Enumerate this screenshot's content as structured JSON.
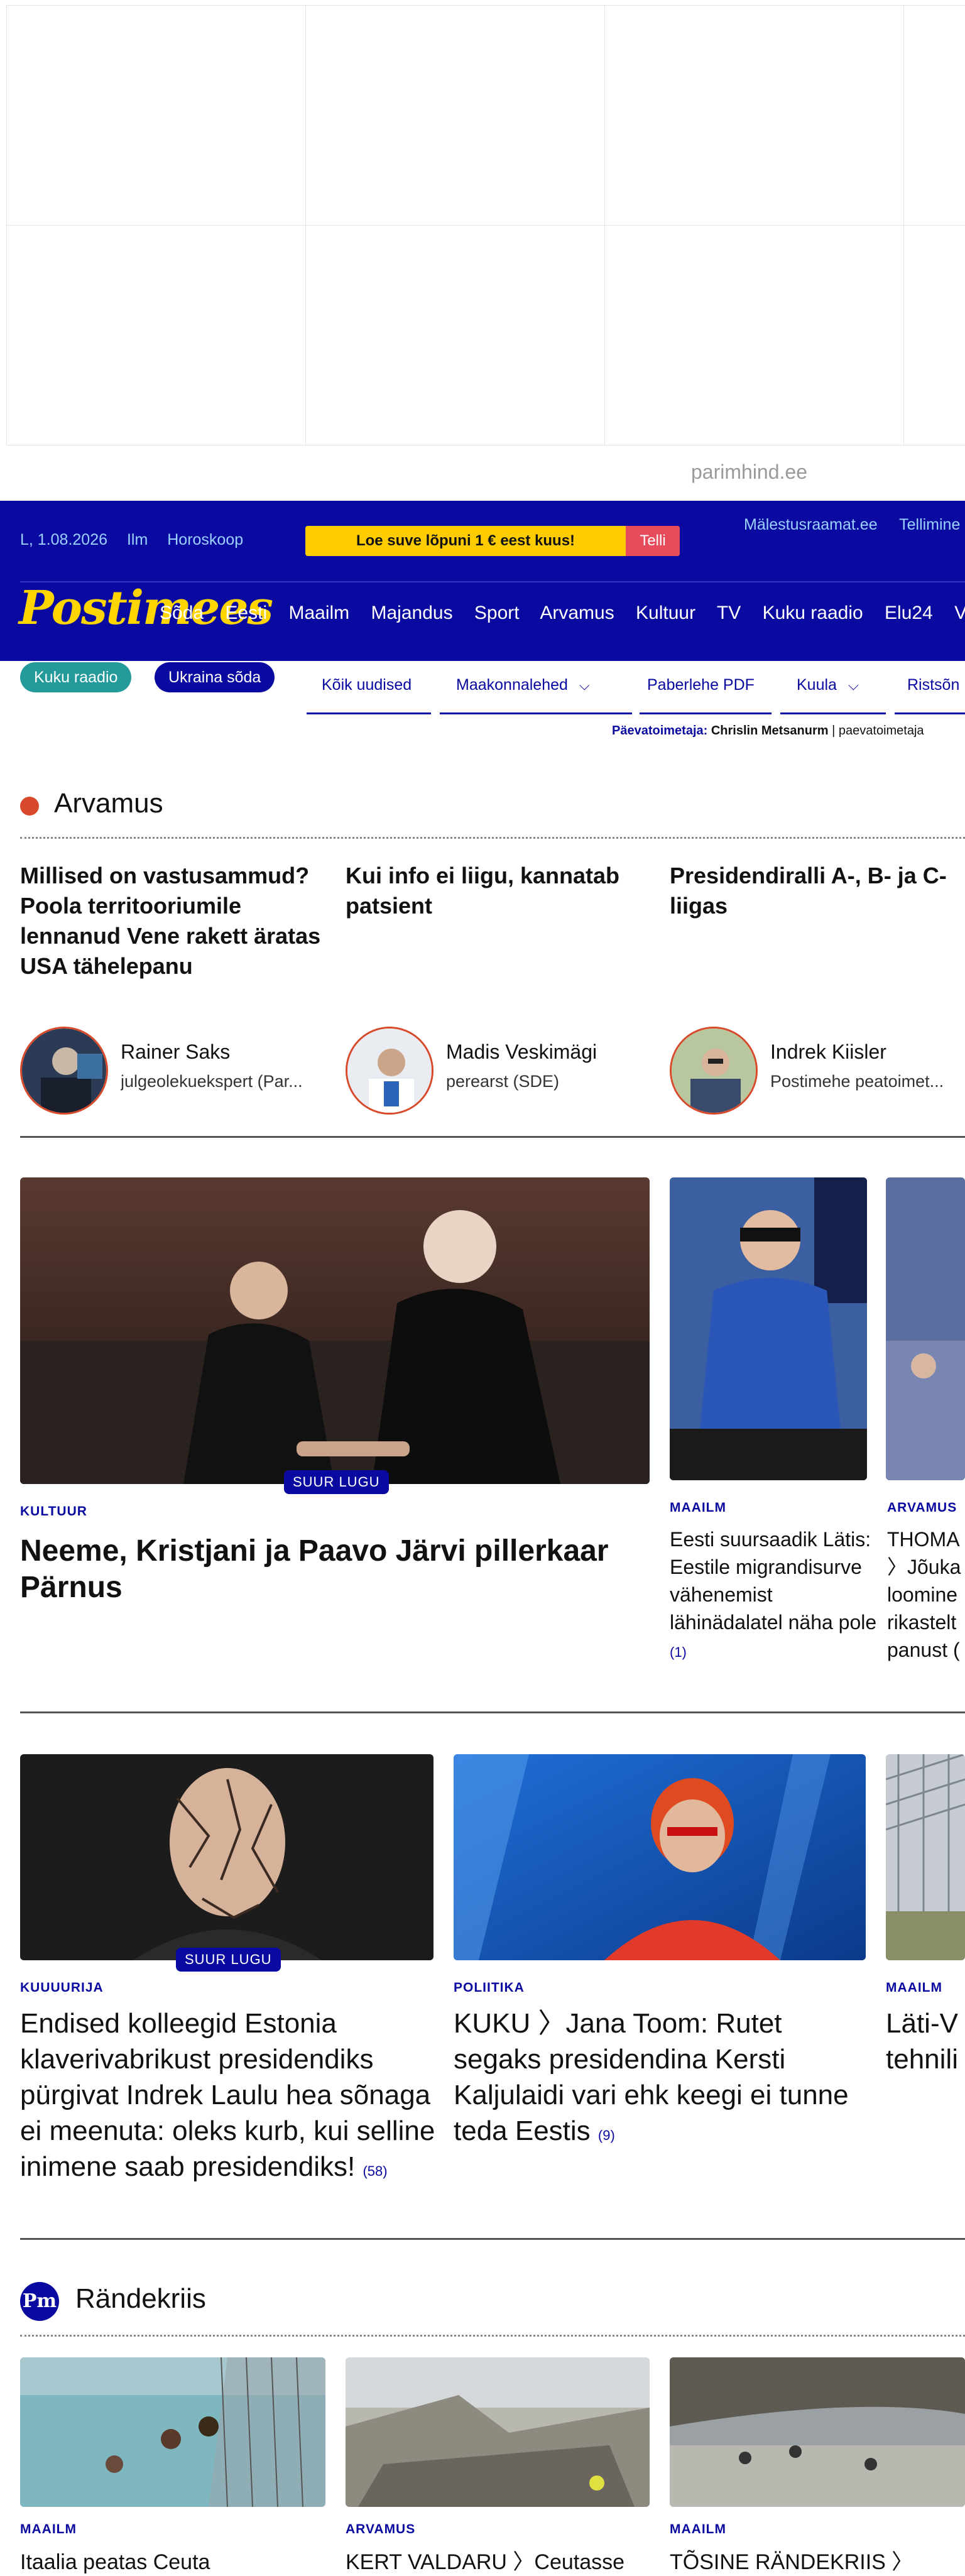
{
  "ad": {
    "source": "parimhind.ee"
  },
  "header": {
    "date": "L, 1.08.2026",
    "weather": "Ilm",
    "horoscope": "Horoskoop",
    "promo_text": "Loe suve lõpuni 1 € eest kuus!",
    "promo_button": "Telli",
    "top_links": [
      "Mälestusraamat.ee",
      "Tellimine"
    ],
    "logo": "Postimees",
    "nav": [
      "Sõda",
      "Eesti",
      "Maailm",
      "Majandus",
      "Sport",
      "Arvamus",
      "Kultuur",
      "TV",
      "Kuku raadio",
      "Elu24",
      "Vee"
    ]
  },
  "subnav": {
    "pills": [
      "Kuku raadio",
      "Ukraina sõda"
    ],
    "tabs": [
      "Kõik uudised",
      "Maakonnalehed",
      "Paberlehe PDF",
      "Kuula",
      "Ristsõn"
    ],
    "editor_label": "Päevatoimetaja:",
    "editor_name": "Chrislin Metsanurm",
    "editor_extra": "paevatoimetaja"
  },
  "opinion": {
    "title": "Arvamus",
    "items": [
      {
        "headline": "Millised on vastusammud? Poola territooriumile lennanud Vene rakett äratas USA tähelepanu",
        "author": "Rainer Saks",
        "role": "julgeolekuekspert (Par..."
      },
      {
        "headline": "Kui info ei liigu, kannatab patsient",
        "author": "Madis Veskimägi",
        "role": "perearst (SDE)"
      },
      {
        "headline": "Presidendiralli A-, B- ja C-liigas",
        "author": "Indrek Kiisler",
        "role": "Postimehe peatoimet..."
      }
    ]
  },
  "stories_row1": [
    {
      "category": "KULTUUR",
      "badge": "SUUR LUGU",
      "headline": "Neeme, Kristjani ja Paavo Järvi pillerkaar Pärnus"
    },
    {
      "category": "MAAILM",
      "headline": "Eesti suursaadik Lätis: Eestile migrandisurve vähenemist lähinädalatel näha pole",
      "comments": "(1)"
    },
    {
      "category": "ARVAMUS",
      "headline": "THOMA 〉Jõuka loomine rikastelt panust ("
    }
  ],
  "stories_row2": [
    {
      "category": "KUUUURIJA",
      "badge": "SUUR LUGU",
      "headline": "Endised kolleegid Estonia klaverivabrikust presidendiks pürgivat Indrek Laulu hea sõnaga ei meenuta: oleks kurb, kui selline inimene saab presidendiks!",
      "comments": "(58)"
    },
    {
      "category": "POLIITIKA",
      "headline": "KUKU 〉Jana Toom: Rutet segaks presidendina Kersti Kaljulaidi vari ehk keegi ei tunne teda Eestis",
      "comments": "(9)"
    },
    {
      "category": "MAAILM",
      "headline": "Läti-V tehnili"
    }
  ],
  "crisis": {
    "title": "Rändekriis",
    "badge": "Pm",
    "items": [
      {
        "category": "MAAILM",
        "headline": "Itaalia peatas Ceuta"
      },
      {
        "category": "ARVAMUS",
        "headline": "KERT VALDARU 〉Ceutasse"
      },
      {
        "category": "MAAILM",
        "headline": "TÕSINE RÄNDEKRIIS 〉"
      }
    ]
  }
}
